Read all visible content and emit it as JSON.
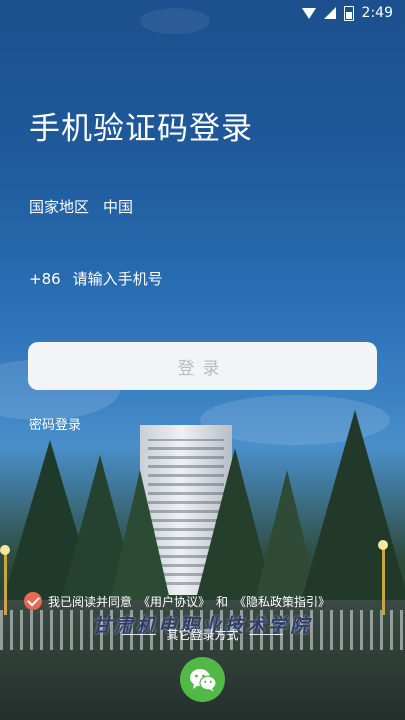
{
  "status_bar": {
    "time": "2:49"
  },
  "page": {
    "title": "手机验证码登录"
  },
  "region": {
    "label": "国家地区",
    "value": "中国"
  },
  "phone": {
    "country_code": "+86",
    "placeholder": "请输入手机号",
    "value": ""
  },
  "login_button": {
    "label": "登录"
  },
  "password_login": {
    "label": "密码登录"
  },
  "agreement": {
    "checked": true,
    "prefix": "我已阅读并同意",
    "user_agreement": "《用户协议》",
    "conjunction": "和",
    "privacy_policy": "《隐私政策指引》"
  },
  "other_login": {
    "label": "其它登录方式",
    "options": [
      {
        "icon": "wechat-icon"
      }
    ]
  },
  "background": {
    "gate_text": "甘肃机电职业技术学院"
  },
  "colors": {
    "accent_check": "#e46a50",
    "wechat": "#52b948",
    "button_bg": "#f3f4f6",
    "button_text": "#b9bcc2"
  }
}
